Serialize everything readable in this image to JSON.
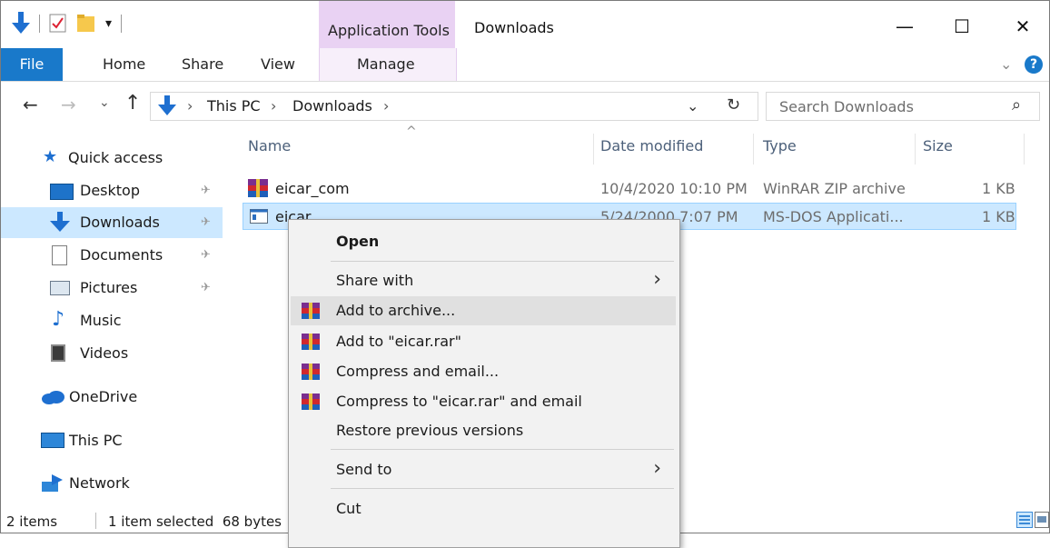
{
  "window": {
    "title": "Downloads",
    "context_tab_header": "Application Tools",
    "minimize": "—",
    "maximize": "☐",
    "close": "✕"
  },
  "ribbon": {
    "tabs": [
      "File",
      "Home",
      "Share",
      "View",
      "Manage"
    ],
    "expand": "⌄",
    "help": "?"
  },
  "address": {
    "back": "←",
    "forward": "→",
    "recent": "⌄",
    "up": "↑",
    "sep": "›",
    "crumbs": [
      "This PC",
      "Downloads"
    ],
    "dropdown": "⌄",
    "refresh": "↻",
    "search_placeholder": "Search Downloads",
    "search_icon": "⌕"
  },
  "nav": {
    "items": [
      {
        "label": "Quick access",
        "icon": "star-icon"
      },
      {
        "label": "Desktop",
        "icon": "desktop-icon",
        "pinned": true
      },
      {
        "label": "Downloads",
        "icon": "download-arrow-icon",
        "pinned": true,
        "selected": true
      },
      {
        "label": "Documents",
        "icon": "documents-icon",
        "pinned": true
      },
      {
        "label": "Pictures",
        "icon": "pictures-icon",
        "pinned": true
      },
      {
        "label": "Music",
        "icon": "music-icon"
      },
      {
        "label": "Videos",
        "icon": "videos-icon"
      },
      {
        "label": "OneDrive",
        "icon": "cloud-icon"
      },
      {
        "label": "This PC",
        "icon": "computer-icon"
      },
      {
        "label": "Network",
        "icon": "network-icon"
      }
    ],
    "pin_glyph": "✈"
  },
  "files": {
    "sort_indicator": "^",
    "columns": [
      "Name",
      "Date modified",
      "Type",
      "Size"
    ],
    "rows": [
      {
        "name": "eicar_com",
        "date": "10/4/2020 10:10 PM",
        "type": "WinRAR ZIP archive",
        "size": "1 KB",
        "icon": "winrar-icon"
      },
      {
        "name": "eicar",
        "date": "5/24/2000 7:07 PM",
        "type": "MS-DOS Applicati...",
        "size": "1 KB",
        "icon": "msdos-app-icon",
        "selected": true
      }
    ]
  },
  "context_menu": {
    "items": [
      {
        "label": "Open",
        "bold": true
      },
      {
        "label": "Share with",
        "submenu": true
      },
      {
        "label": "Add to archive...",
        "icon": "winrar-icon",
        "highlighted": true
      },
      {
        "label": "Add to \"eicar.rar\"",
        "icon": "winrar-icon"
      },
      {
        "label": "Compress and email...",
        "icon": "winrar-icon"
      },
      {
        "label": "Compress to \"eicar.rar\" and email",
        "icon": "winrar-icon"
      },
      {
        "label": "Restore previous versions"
      },
      {
        "label": "Send to",
        "submenu": true
      },
      {
        "label": "Cut"
      }
    ],
    "submenu_arrow": "›"
  },
  "status": {
    "items_count": "2 items",
    "selection": "1 item selected  68 bytes"
  },
  "colors": {
    "file_tab": "#1979ca",
    "selection": "#cce8ff",
    "context_tab": "#e9d2f3"
  }
}
